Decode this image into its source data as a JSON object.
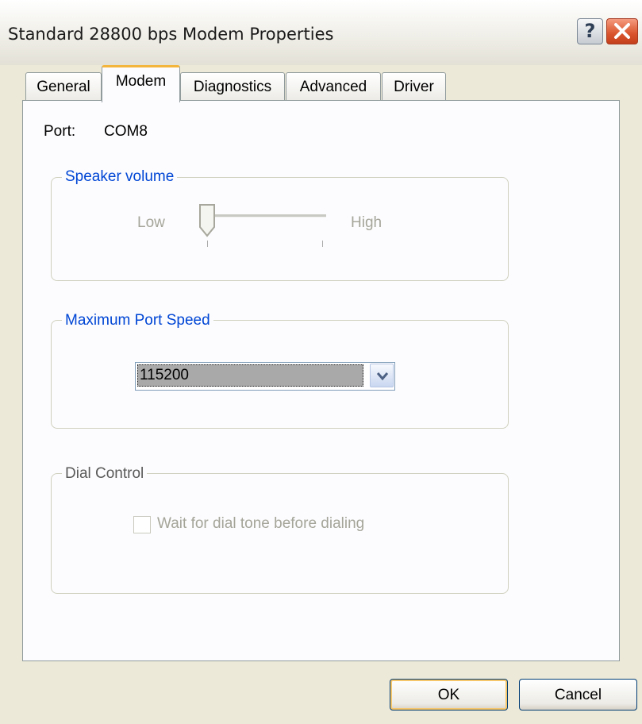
{
  "window": {
    "title": "Standard 28800 bps Modem Properties",
    "help_button": "?",
    "accent_color": "#f3b53b"
  },
  "tabs": [
    {
      "label": "General"
    },
    {
      "label": "Modem",
      "active": true
    },
    {
      "label": "Diagnostics"
    },
    {
      "label": "Advanced"
    },
    {
      "label": "Driver"
    }
  ],
  "port": {
    "label": "Port:",
    "value": "COM8"
  },
  "speaker_volume": {
    "title": "Speaker volume",
    "low_label": "Low",
    "high_label": "High",
    "level": 0,
    "enabled": false
  },
  "max_port_speed": {
    "title": "Maximum Port Speed",
    "selected": "115200"
  },
  "dial_control": {
    "title": "Dial Control",
    "checkbox_label": "Wait for dial tone before dialing",
    "checked": false,
    "enabled": false
  },
  "buttons": {
    "ok": "OK",
    "cancel": "Cancel"
  }
}
